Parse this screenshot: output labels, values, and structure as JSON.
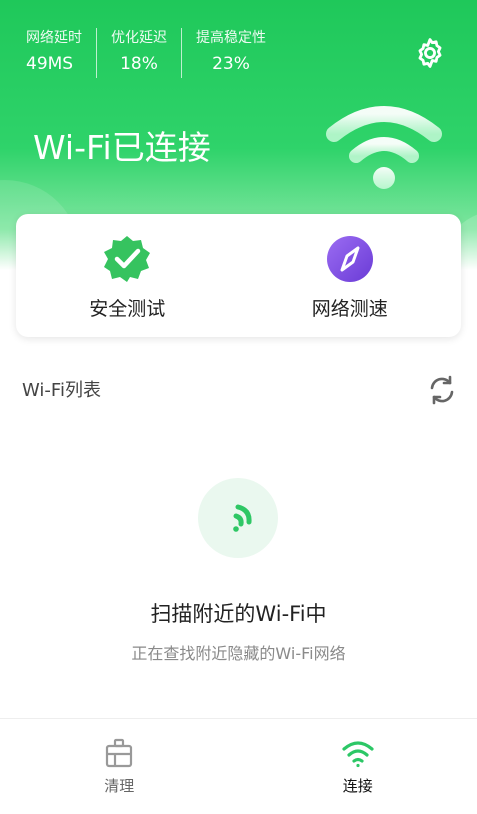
{
  "header": {
    "stats": [
      {
        "label": "网络延时",
        "value": "49MS"
      },
      {
        "label": "优化延迟",
        "value": "18%"
      },
      {
        "label": "提高稳定性",
        "value": "23%"
      }
    ],
    "settings_icon": "gear-icon",
    "title": "Wi-Fi已连接",
    "wifi_icon": "wifi-icon"
  },
  "actions": [
    {
      "label": "安全测试",
      "icon": "shield-check-icon",
      "color": "#2fbf5a"
    },
    {
      "label": "网络测速",
      "icon": "compass-icon",
      "color": "#7b48e0"
    }
  ],
  "wifi_list": {
    "title": "Wi-Fi列表",
    "refresh_icon": "refresh-icon"
  },
  "scanning": {
    "icon": "wifi-scan-icon",
    "title": "扫描附近的Wi-Fi中",
    "subtitle": "正在查找附近隐藏的Wi-Fi网络"
  },
  "bottom_nav": [
    {
      "label": "清理",
      "icon": "clean-icon",
      "active": false
    },
    {
      "label": "连接",
      "icon": "wifi-icon",
      "active": true
    }
  ],
  "colors": {
    "brand_green": "#1fc85a",
    "accent_purple": "#7b48e0"
  }
}
